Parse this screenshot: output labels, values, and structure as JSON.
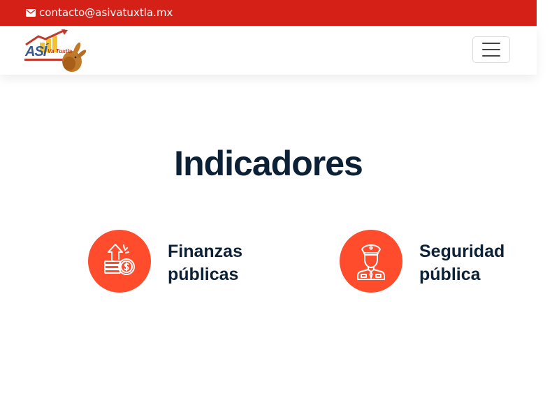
{
  "topbar": {
    "icon": "mail-icon",
    "email": "contacto@asivatuxtla.mx"
  },
  "navbar": {
    "logo": {
      "text_main": "ASÍ",
      "text_sub": "Va Tuxtla"
    },
    "menu_toggle_icon": "hamburger-menu-icon"
  },
  "main": {
    "title": "Indicadores",
    "indicators": [
      {
        "icon": "finance-growth-icon",
        "label_line1": "Finanzas",
        "label_line2": "públicas"
      },
      {
        "icon": "police-officer-icon",
        "label_line1": "Seguridad",
        "label_line2": "pública"
      }
    ]
  },
  "colors": {
    "topbar_bg": "#d42017",
    "accent_circle": "#fe4c2c",
    "heading": "#0c2136"
  }
}
